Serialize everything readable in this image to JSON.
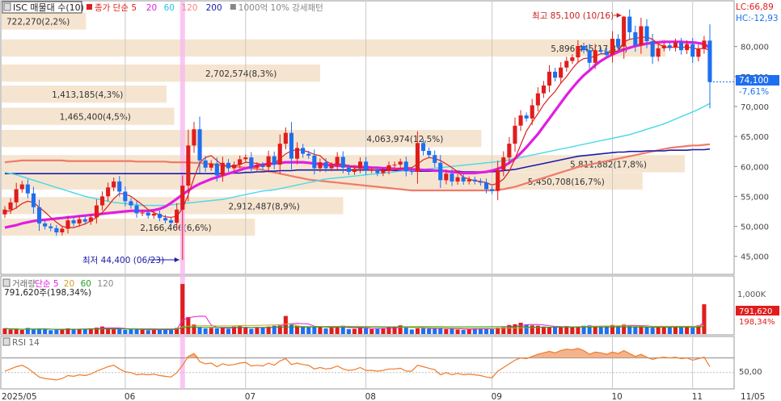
{
  "chart_data": {
    "type": "candlestick",
    "main_panel": {
      "title_box": "ISC 매물대 수(10)",
      "legend": [
        {
          "label": "종가 단순 5",
          "color": "#e11d1d"
        },
        {
          "label": "20",
          "color": "#e11de1"
        },
        {
          "label": "60",
          "color": "#1ec8e0"
        },
        {
          "label": "120",
          "color": "#ff8080"
        },
        {
          "label": "200",
          "color": "#1a1aa8"
        },
        {
          "label": "1000억 10% 강세패턴",
          "color": "#888888"
        }
      ],
      "lc_label": "LC:66,89",
      "hc_label": "HC:-12,93",
      "y_axis": {
        "ticks": [
          45000,
          50000,
          55000,
          60000,
          65000,
          70000,
          75000,
          80000
        ],
        "labels": [
          "45,000",
          "50,000",
          "55,000",
          "60,000",
          "65,000",
          "70,000",
          "75,000",
          "80,000"
        ],
        "range": [
          42000,
          87500
        ]
      },
      "current_price": {
        "value": 74100,
        "label": "74,100",
        "change": "-7,61%",
        "color": "#1e6ff0"
      },
      "high_annotation": "최고 85,100 (10/16)",
      "low_annotation": "최저 44,400 (06/23)",
      "volume_profile": [
        {
          "price": 84200,
          "label": "722,270(2,2%)",
          "pct": 2.2
        },
        {
          "price": 79700,
          "label": "5,896,445(17,3%)",
          "pct": 17.3
        },
        {
          "price": 75500,
          "label": "2,702,574(8,3%)",
          "pct": 8.3
        },
        {
          "price": 72000,
          "label": "1,413,185(4,3%)",
          "pct": 4.3
        },
        {
          "price": 68300,
          "label": "1,465,400(4,5%)",
          "pct": 4.5
        },
        {
          "price": 64600,
          "label": "4,063,974(12,5%)",
          "pct": 12.5
        },
        {
          "price": 60400,
          "label": "5,811,882(17,8%)",
          "pct": 17.8
        },
        {
          "price": 57500,
          "label": "5,450,708(16,7%)",
          "pct": 16.7
        },
        {
          "price": 53400,
          "label": "2,912,487(8,9%)",
          "pct": 8.9
        },
        {
          "price": 49800,
          "label": "2,166,466(6,6%)",
          "pct": 6.6
        }
      ],
      "x_labels": [
        "2025/05",
        "06",
        "07",
        "08",
        "09",
        "10",
        "11",
        "11/05"
      ],
      "closes": [
        52800,
        54000,
        56200,
        57000,
        55500,
        53200,
        50500,
        50000,
        49700,
        49000,
        49600,
        51000,
        50500,
        51200,
        50800,
        51500,
        53500,
        55000,
        56500,
        57500,
        55800,
        54200,
        53500,
        52200,
        52300,
        51800,
        52100,
        51400,
        51000,
        50600,
        52800,
        56800,
        63500,
        66200,
        61000,
        59800,
        60500,
        58500,
        60600,
        59700,
        60300,
        61200,
        61500,
        59800,
        60200,
        59900,
        61700,
        60300,
        63800,
        65600,
        61300,
        63100,
        62100,
        61800,
        59700,
        60700,
        59700,
        60200,
        61600,
        59800,
        59100,
        59600,
        60800,
        59400,
        59400,
        58900,
        59300,
        60200,
        60300,
        60800,
        59200,
        59100,
        63900,
        62600,
        61900,
        60600,
        57700,
        58800,
        57500,
        58200,
        57500,
        57800,
        57500,
        57300,
        56200,
        55900,
        59400,
        61500,
        63800,
        66800,
        68500,
        68000,
        70200,
        72200,
        73500,
        75800,
        74800,
        76500,
        77600,
        78200,
        80100,
        79400,
        77300,
        79400,
        79200,
        78600,
        81300,
        80000,
        85000,
        82400,
        80200,
        83400,
        80900,
        78300,
        79700,
        80200,
        79800,
        80700,
        79400,
        80400,
        78300,
        79600,
        81000,
        74100
      ],
      "ma5": [
        52500,
        52600,
        53100,
        53800,
        54200,
        54000,
        53200,
        52400,
        51500,
        50700,
        50000,
        49800,
        49800,
        50100,
        50400,
        50900,
        51500,
        52300,
        53400,
        54600,
        55500,
        55400,
        55000,
        54300,
        53600,
        52800,
        52300,
        51900,
        51600,
        51500,
        51700,
        53000,
        55300,
        58100,
        60600,
        61500,
        61800,
        61000,
        60200,
        59900,
        60100,
        60300,
        60700,
        60600,
        60500,
        60300,
        60400,
        60500,
        61300,
        62100,
        62600,
        62800,
        62700,
        62400,
        62000,
        61800,
        60900,
        60400,
        60400,
        60400,
        60100,
        59800,
        59800,
        59600,
        59400,
        59400,
        59300,
        59300,
        59400,
        59700,
        59800,
        59800,
        60400,
        61100,
        61500,
        61300,
        61000,
        60400,
        59800,
        59100,
        58200,
        57900,
        57600,
        57500,
        57300,
        56900,
        57200,
        57900,
        59200,
        61300,
        63600,
        65900,
        67400,
        68800,
        70300,
        71500,
        72500,
        73900,
        75000,
        76300,
        77400,
        78000,
        78100,
        78400,
        78800,
        78800,
        79100,
        79300,
        80800,
        81200,
        81400,
        81500,
        81600,
        81200,
        80400,
        80000,
        79800,
        80000,
        79800,
        80000,
        79700,
        79600,
        79700,
        79400
      ],
      "ma20": [
        49800,
        50000,
        50200,
        50500,
        50700,
        50900,
        51000,
        51100,
        51200,
        51300,
        51400,
        51500,
        51600,
        51700,
        51800,
        51900,
        52000,
        52100,
        52200,
        52300,
        52400,
        52500,
        52600,
        52600,
        52600,
        52600,
        52700,
        52900,
        53300,
        53900,
        54600,
        55300,
        56000,
        56600,
        57100,
        57500,
        57900,
        58200,
        58500,
        58800,
        59100,
        59400,
        59700,
        59900,
        60100,
        60300,
        60400,
        60500,
        60600,
        60700,
        60700,
        60700,
        60700,
        60600,
        60500,
        60400,
        60300,
        60200,
        60100,
        60100,
        60000,
        60000,
        59900,
        59900,
        59800,
        59800,
        59700,
        59700,
        59600,
        59600,
        59500,
        59500,
        59500,
        59400,
        59400,
        59300,
        59300,
        59200,
        59100,
        59000,
        58900,
        58900,
        58900,
        59000,
        59100,
        59300,
        59600,
        60000,
        60600,
        61300,
        62200,
        63200,
        64300,
        65400,
        66700,
        68000,
        69300,
        70600,
        71900,
        73100,
        74200,
        75200,
        76000,
        76900,
        77600,
        78200,
        78700,
        79100,
        79500,
        79800,
        80100,
        80300,
        80500,
        80600,
        80700,
        80800,
        80800,
        80800,
        80800,
        80700,
        80700,
        80600,
        80400,
        79800
      ],
      "ma60": [
        59000,
        58800,
        58600,
        58300,
        58000,
        57700,
        57400,
        57100,
        56800,
        56500,
        56200,
        55900,
        55600,
        55300,
        55000,
        54800,
        54600,
        54400,
        54200,
        54000,
        53900,
        53800,
        53700,
        53600,
        53500,
        53500,
        53500,
        53500,
        53500,
        53600,
        53700,
        53800,
        53900,
        54000,
        54100,
        54200,
        54300,
        54400,
        54500,
        54700,
        54900,
        55100,
        55300,
        55500,
        55700,
        55900,
        56000,
        56100,
        56300,
        56500,
        56700,
        56900,
        57100,
        57300,
        57500,
        57700,
        57900,
        58000,
        58100,
        58200,
        58300,
        58400,
        58500,
        58600,
        58700,
        58800,
        58900,
        59000,
        59100,
        59200,
        59300,
        59300,
        59400,
        59500,
        59600,
        59700,
        59800,
        59900,
        60000,
        60100,
        60200,
        60300,
        60400,
        60500,
        60600,
        60700,
        60800,
        60900,
        61100,
        61300,
        61500,
        61700,
        61900,
        62100,
        62300,
        62500,
        62700,
        62900,
        63100,
        63300,
        63500,
        63700,
        63900,
        64100,
        64300,
        64500,
        64700,
        64900,
        65100,
        65300,
        65600,
        65900,
        66200,
        66500,
        66800,
        67100,
        67500,
        67900,
        68300,
        68700,
        69100,
        69500,
        70000,
        70500
      ],
      "ma120": [
        60700,
        60800,
        60900,
        61000,
        61000,
        61000,
        61000,
        61000,
        61000,
        61000,
        61000,
        60900,
        60900,
        60900,
        60900,
        60900,
        60900,
        60900,
        60900,
        60900,
        60900,
        60900,
        60900,
        60800,
        60800,
        60800,
        60800,
        60800,
        60800,
        60700,
        60700,
        60700,
        60700,
        60600,
        60600,
        60500,
        60400,
        60300,
        60200,
        60100,
        60000,
        59900,
        59800,
        59700,
        59600,
        59400,
        59200,
        59000,
        58800,
        58600,
        58400,
        58200,
        58000,
        57800,
        57700,
        57600,
        57500,
        57400,
        57300,
        57200,
        57100,
        57000,
        56900,
        56800,
        56700,
        56600,
        56500,
        56400,
        56300,
        56200,
        56100,
        56000,
        56000,
        56000,
        56000,
        56000,
        56000,
        56000,
        56000,
        56000,
        56000,
        56000,
        56000,
        56000,
        56000,
        56000,
        56100,
        56200,
        56400,
        56600,
        56900,
        57200,
        57500,
        57800,
        58100,
        58400,
        58700,
        59000,
        59300,
        59600,
        59900,
        60100,
        60300,
        60500,
        60700,
        60900,
        61100,
        61300,
        61500,
        61700,
        61900,
        62100,
        62300,
        62500,
        62700,
        62900,
        63100,
        63200,
        63300,
        63400,
        63500,
        63500,
        63600,
        63700
      ],
      "ma200": [
        58800,
        58800,
        58800,
        58800,
        58800,
        58800,
        58800,
        58800,
        58800,
        58800,
        58800,
        58800,
        58800,
        58800,
        58800,
        58800,
        58800,
        58800,
        58800,
        58800,
        58800,
        58800,
        58800,
        58800,
        58800,
        58800,
        58800,
        58800,
        58800,
        58800,
        58800,
        58800,
        58800,
        58800,
        58800,
        58800,
        58800,
        58800,
        58800,
        58800,
        58900,
        58900,
        59000,
        59000,
        59100,
        59100,
        59200,
        59200,
        59300,
        59300,
        59300,
        59400,
        59400,
        59400,
        59400,
        59400,
        59400,
        59400,
        59400,
        59400,
        59400,
        59400,
        59400,
        59400,
        59400,
        59400,
        59400,
        59400,
        59300,
        59300,
        59300,
        59300,
        59200,
        59200,
        59200,
        59200,
        59200,
        59200,
        59200,
        59200,
        59100,
        59100,
        59100,
        59100,
        59100,
        59100,
        59200,
        59300,
        59400,
        59500,
        59700,
        59900,
        60100,
        60300,
        60500,
        60700,
        60900,
        61100,
        61300,
        61500,
        61700,
        61800,
        61900,
        62000,
        62100,
        62200,
        62300,
        62400,
        62400,
        62500,
        62500,
        62500,
        62600,
        62600,
        62600,
        62600,
        62700,
        62700,
        62700,
        62700,
        62800,
        62800,
        62800,
        62900
      ]
    },
    "volume_panel": {
      "legend": [
        {
          "label": "거래량",
          "color": "#666666"
        },
        {
          "label": "단순 5",
          "color": "#e11de1"
        },
        {
          "label": "20",
          "color": "#d4a017"
        },
        {
          "label": "60",
          "color": "#20a020"
        },
        {
          "label": "120",
          "color": "#888888"
        }
      ],
      "last_label": "791,620주(198,34%)",
      "axis_label": "1,000K",
      "current_value": "791,620",
      "current_pct": "198,34%",
      "range": [
        0,
        1330000
      ],
      "volumes": [
        150000,
        120000,
        130000,
        110000,
        160000,
        120000,
        140000,
        130000,
        100000,
        110000,
        120000,
        150000,
        130000,
        140000,
        120000,
        150000,
        170000,
        200000,
        160000,
        140000,
        130000,
        110000,
        120000,
        130000,
        120000,
        100000,
        110000,
        120000,
        130000,
        110000,
        160000,
        1330000,
        450000,
        250000,
        180000,
        150000,
        160000,
        150000,
        170000,
        140000,
        200000,
        210000,
        170000,
        140000,
        160000,
        180000,
        200000,
        220000,
        230000,
        480000,
        250000,
        220000,
        200000,
        180000,
        190000,
        200000,
        150000,
        170000,
        190000,
        220000,
        130000,
        140000,
        170000,
        150000,
        130000,
        140000,
        160000,
        180000,
        190000,
        230000,
        180000,
        120000,
        150000,
        160000,
        140000,
        150000,
        170000,
        130000,
        140000,
        120000,
        110000,
        130000,
        150000,
        160000,
        140000,
        130000,
        170000,
        180000,
        240000,
        260000,
        300000,
        250000,
        230000,
        220000,
        200000,
        190000,
        180000,
        200000,
        210000,
        180000,
        200000,
        220000,
        230000,
        200000,
        190000,
        210000,
        240000,
        220000,
        250000,
        230000,
        200000,
        220000,
        190000,
        170000,
        180000,
        200000,
        190000,
        210000,
        180000,
        200000,
        170000,
        230000,
        791620
      ]
    },
    "rsi_panel": {
      "label": "RSI 14",
      "axis_label": "50,00",
      "range": [
        0,
        100
      ],
      "values": [
        52,
        55,
        58,
        60,
        56,
        50,
        44,
        42,
        41,
        40,
        42,
        46,
        45,
        47,
        46,
        48,
        52,
        55,
        58,
        60,
        55,
        51,
        50,
        47,
        48,
        47,
        48,
        46,
        45,
        44,
        50,
        60,
        72,
        76,
        65,
        62,
        63,
        58,
        62,
        60,
        61,
        63,
        64,
        59,
        60,
        59,
        63,
        60,
        66,
        69,
        61,
        63,
        61,
        60,
        55,
        57,
        55,
        56,
        59,
        55,
        53,
        54,
        57,
        53,
        53,
        52,
        53,
        55,
        55,
        56,
        52,
        52,
        60,
        58,
        56,
        54,
        47,
        50,
        47,
        49,
        47,
        48,
        47,
        46,
        44,
        43,
        52,
        57,
        62,
        67,
        70,
        69,
        72,
        75,
        77,
        79,
        77,
        80,
        82,
        81,
        83,
        80,
        75,
        78,
        77,
        75,
        78,
        76,
        80,
        76,
        72,
        75,
        71,
        68,
        70,
        71,
        70,
        71,
        69,
        70,
        67,
        69,
        71,
        58
      ]
    }
  }
}
